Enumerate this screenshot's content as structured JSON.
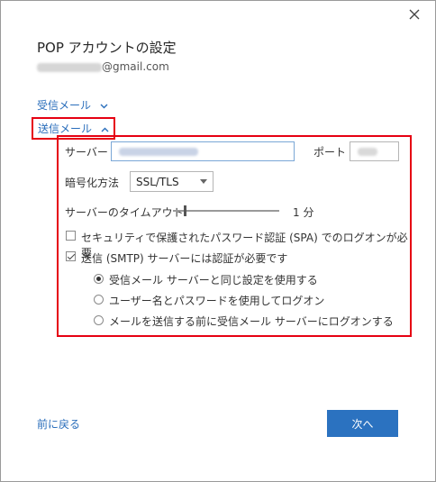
{
  "window": {
    "close_icon": "close-icon"
  },
  "header": {
    "title": "POP アカウントの設定",
    "email_suffix": "@gmail.com"
  },
  "sections": {
    "incoming_label": "受信メール",
    "outgoing_label": "送信メール"
  },
  "outgoing": {
    "server_label": "サーバー",
    "port_label": "ポート",
    "encryption_label": "暗号化方法",
    "encryption_value": "SSL/TLS",
    "timeout_label": "サーバーのタイムアウト",
    "timeout_value": "1 分",
    "timeout_fraction": 0.1,
    "spa_label": "セキュリティで保護されたパスワード認証 (SPA) でのログオンが必要",
    "spa_checked": false,
    "smtp_auth_label": "送信 (SMTP) サーバーには認証が必要です",
    "smtp_auth_checked": true,
    "radio_options": [
      {
        "label": "受信メール サーバーと同じ設定を使用する",
        "selected": true
      },
      {
        "label": "ユーザー名とパスワードを使用してログオン",
        "selected": false
      },
      {
        "label": "メールを送信する前に受信メール サーバーにログオンする",
        "selected": false
      }
    ]
  },
  "footer": {
    "back_label": "前に戻る",
    "next_label": "次へ"
  },
  "colors": {
    "accent": "#2b72c0",
    "link": "#2a6ebb",
    "highlight": "#e60012"
  }
}
